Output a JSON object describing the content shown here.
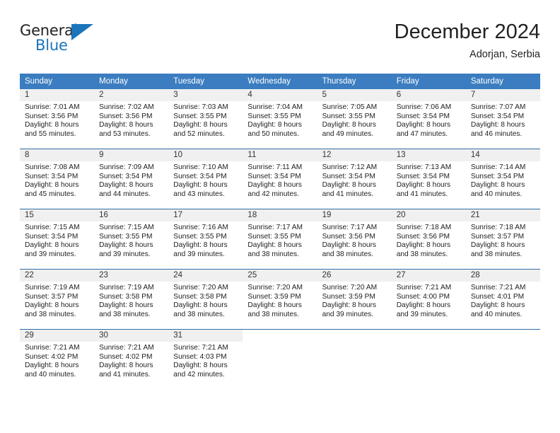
{
  "brand": {
    "name_part1": "General",
    "name_part2": "Blue",
    "triangle_color": "#1b75bb"
  },
  "header": {
    "title": "December 2024",
    "subtitle": "Adorjan, Serbia"
  },
  "theme": {
    "header_bg": "#3b7dc0",
    "row_divider": "#2e6da4",
    "daynum_bg": "#f0f0f0",
    "text": "#222222"
  },
  "weekday_headers": [
    "Sunday",
    "Monday",
    "Tuesday",
    "Wednesday",
    "Thursday",
    "Friday",
    "Saturday"
  ],
  "weeks": [
    [
      {
        "day": "1",
        "sunrise": "Sunrise: 7:01 AM",
        "sunset": "Sunset: 3:56 PM",
        "daylight1": "Daylight: 8 hours",
        "daylight2": "and 55 minutes."
      },
      {
        "day": "2",
        "sunrise": "Sunrise: 7:02 AM",
        "sunset": "Sunset: 3:56 PM",
        "daylight1": "Daylight: 8 hours",
        "daylight2": "and 53 minutes."
      },
      {
        "day": "3",
        "sunrise": "Sunrise: 7:03 AM",
        "sunset": "Sunset: 3:55 PM",
        "daylight1": "Daylight: 8 hours",
        "daylight2": "and 52 minutes."
      },
      {
        "day": "4",
        "sunrise": "Sunrise: 7:04 AM",
        "sunset": "Sunset: 3:55 PM",
        "daylight1": "Daylight: 8 hours",
        "daylight2": "and 50 minutes."
      },
      {
        "day": "5",
        "sunrise": "Sunrise: 7:05 AM",
        "sunset": "Sunset: 3:55 PM",
        "daylight1": "Daylight: 8 hours",
        "daylight2": "and 49 minutes."
      },
      {
        "day": "6",
        "sunrise": "Sunrise: 7:06 AM",
        "sunset": "Sunset: 3:54 PM",
        "daylight1": "Daylight: 8 hours",
        "daylight2": "and 47 minutes."
      },
      {
        "day": "7",
        "sunrise": "Sunrise: 7:07 AM",
        "sunset": "Sunset: 3:54 PM",
        "daylight1": "Daylight: 8 hours",
        "daylight2": "and 46 minutes."
      }
    ],
    [
      {
        "day": "8",
        "sunrise": "Sunrise: 7:08 AM",
        "sunset": "Sunset: 3:54 PM",
        "daylight1": "Daylight: 8 hours",
        "daylight2": "and 45 minutes."
      },
      {
        "day": "9",
        "sunrise": "Sunrise: 7:09 AM",
        "sunset": "Sunset: 3:54 PM",
        "daylight1": "Daylight: 8 hours",
        "daylight2": "and 44 minutes."
      },
      {
        "day": "10",
        "sunrise": "Sunrise: 7:10 AM",
        "sunset": "Sunset: 3:54 PM",
        "daylight1": "Daylight: 8 hours",
        "daylight2": "and 43 minutes."
      },
      {
        "day": "11",
        "sunrise": "Sunrise: 7:11 AM",
        "sunset": "Sunset: 3:54 PM",
        "daylight1": "Daylight: 8 hours",
        "daylight2": "and 42 minutes."
      },
      {
        "day": "12",
        "sunrise": "Sunrise: 7:12 AM",
        "sunset": "Sunset: 3:54 PM",
        "daylight1": "Daylight: 8 hours",
        "daylight2": "and 41 minutes."
      },
      {
        "day": "13",
        "sunrise": "Sunrise: 7:13 AM",
        "sunset": "Sunset: 3:54 PM",
        "daylight1": "Daylight: 8 hours",
        "daylight2": "and 41 minutes."
      },
      {
        "day": "14",
        "sunrise": "Sunrise: 7:14 AM",
        "sunset": "Sunset: 3:54 PM",
        "daylight1": "Daylight: 8 hours",
        "daylight2": "and 40 minutes."
      }
    ],
    [
      {
        "day": "15",
        "sunrise": "Sunrise: 7:15 AM",
        "sunset": "Sunset: 3:54 PM",
        "daylight1": "Daylight: 8 hours",
        "daylight2": "and 39 minutes."
      },
      {
        "day": "16",
        "sunrise": "Sunrise: 7:15 AM",
        "sunset": "Sunset: 3:55 PM",
        "daylight1": "Daylight: 8 hours",
        "daylight2": "and 39 minutes."
      },
      {
        "day": "17",
        "sunrise": "Sunrise: 7:16 AM",
        "sunset": "Sunset: 3:55 PM",
        "daylight1": "Daylight: 8 hours",
        "daylight2": "and 39 minutes."
      },
      {
        "day": "18",
        "sunrise": "Sunrise: 7:17 AM",
        "sunset": "Sunset: 3:55 PM",
        "daylight1": "Daylight: 8 hours",
        "daylight2": "and 38 minutes."
      },
      {
        "day": "19",
        "sunrise": "Sunrise: 7:17 AM",
        "sunset": "Sunset: 3:56 PM",
        "daylight1": "Daylight: 8 hours",
        "daylight2": "and 38 minutes."
      },
      {
        "day": "20",
        "sunrise": "Sunrise: 7:18 AM",
        "sunset": "Sunset: 3:56 PM",
        "daylight1": "Daylight: 8 hours",
        "daylight2": "and 38 minutes."
      },
      {
        "day": "21",
        "sunrise": "Sunrise: 7:18 AM",
        "sunset": "Sunset: 3:57 PM",
        "daylight1": "Daylight: 8 hours",
        "daylight2": "and 38 minutes."
      }
    ],
    [
      {
        "day": "22",
        "sunrise": "Sunrise: 7:19 AM",
        "sunset": "Sunset: 3:57 PM",
        "daylight1": "Daylight: 8 hours",
        "daylight2": "and 38 minutes."
      },
      {
        "day": "23",
        "sunrise": "Sunrise: 7:19 AM",
        "sunset": "Sunset: 3:58 PM",
        "daylight1": "Daylight: 8 hours",
        "daylight2": "and 38 minutes."
      },
      {
        "day": "24",
        "sunrise": "Sunrise: 7:20 AM",
        "sunset": "Sunset: 3:58 PM",
        "daylight1": "Daylight: 8 hours",
        "daylight2": "and 38 minutes."
      },
      {
        "day": "25",
        "sunrise": "Sunrise: 7:20 AM",
        "sunset": "Sunset: 3:59 PM",
        "daylight1": "Daylight: 8 hours",
        "daylight2": "and 38 minutes."
      },
      {
        "day": "26",
        "sunrise": "Sunrise: 7:20 AM",
        "sunset": "Sunset: 3:59 PM",
        "daylight1": "Daylight: 8 hours",
        "daylight2": "and 39 minutes."
      },
      {
        "day": "27",
        "sunrise": "Sunrise: 7:21 AM",
        "sunset": "Sunset: 4:00 PM",
        "daylight1": "Daylight: 8 hours",
        "daylight2": "and 39 minutes."
      },
      {
        "day": "28",
        "sunrise": "Sunrise: 7:21 AM",
        "sunset": "Sunset: 4:01 PM",
        "daylight1": "Daylight: 8 hours",
        "daylight2": "and 40 minutes."
      }
    ],
    [
      {
        "day": "29",
        "sunrise": "Sunrise: 7:21 AM",
        "sunset": "Sunset: 4:02 PM",
        "daylight1": "Daylight: 8 hours",
        "daylight2": "and 40 minutes."
      },
      {
        "day": "30",
        "sunrise": "Sunrise: 7:21 AM",
        "sunset": "Sunset: 4:02 PM",
        "daylight1": "Daylight: 8 hours",
        "daylight2": "and 41 minutes."
      },
      {
        "day": "31",
        "sunrise": "Sunrise: 7:21 AM",
        "sunset": "Sunset: 4:03 PM",
        "daylight1": "Daylight: 8 hours",
        "daylight2": "and 42 minutes."
      },
      {
        "day": "",
        "sunrise": "",
        "sunset": "",
        "daylight1": "",
        "daylight2": ""
      },
      {
        "day": "",
        "sunrise": "",
        "sunset": "",
        "daylight1": "",
        "daylight2": ""
      },
      {
        "day": "",
        "sunrise": "",
        "sunset": "",
        "daylight1": "",
        "daylight2": ""
      },
      {
        "day": "",
        "sunrise": "",
        "sunset": "",
        "daylight1": "",
        "daylight2": ""
      }
    ]
  ]
}
